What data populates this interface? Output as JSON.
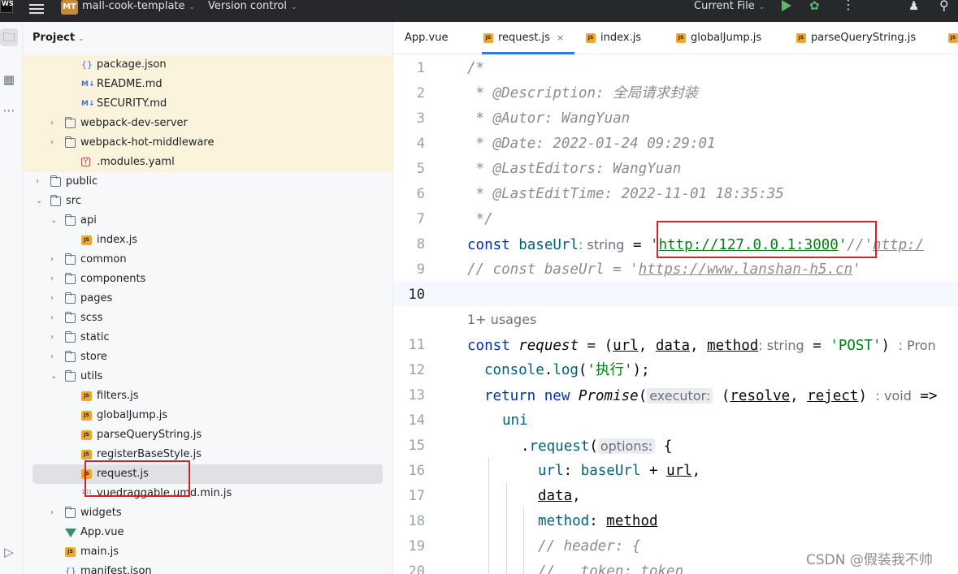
{
  "topbar": {
    "logo": "WS",
    "project_badge": "MT",
    "project_name": "mall-cook-template",
    "vcs": "Version control",
    "run_config": "Current File"
  },
  "project_panel": {
    "title": "Project",
    "tree": [
      {
        "label": "package.json",
        "icon": "json-icon",
        "indent": 3,
        "expand": ""
      },
      {
        "label": "README.md",
        "icon": "markdown-icon",
        "indent": 3,
        "expand": ""
      },
      {
        "label": "SECURITY.md",
        "icon": "markdown-icon",
        "indent": 3,
        "expand": ""
      },
      {
        "label": "webpack-dev-server",
        "icon": "folder-icon",
        "indent": 2,
        "expand": "›"
      },
      {
        "label": "webpack-hot-middleware",
        "icon": "folder-icon",
        "indent": 2,
        "expand": "›"
      },
      {
        "label": ".modules.yaml",
        "icon": "yaml-icon",
        "indent": 3,
        "expand": ""
      },
      {
        "label": "public",
        "icon": "folder-icon",
        "indent": 1,
        "expand": "›"
      },
      {
        "label": "src",
        "icon": "folder-icon",
        "indent": 1,
        "expand": "⌄"
      },
      {
        "label": "api",
        "icon": "folder-icon",
        "indent": 2,
        "expand": "⌄"
      },
      {
        "label": "index.js",
        "icon": "js-icon",
        "indent": 3,
        "expand": ""
      },
      {
        "label": "common",
        "icon": "folder-icon",
        "indent": 2,
        "expand": "›"
      },
      {
        "label": "components",
        "icon": "folder-icon",
        "indent": 2,
        "expand": "›"
      },
      {
        "label": "pages",
        "icon": "folder-icon",
        "indent": 2,
        "expand": "›"
      },
      {
        "label": "scss",
        "icon": "folder-icon",
        "indent": 2,
        "expand": "›"
      },
      {
        "label": "static",
        "icon": "folder-icon",
        "indent": 2,
        "expand": "›"
      },
      {
        "label": "store",
        "icon": "folder-icon",
        "indent": 2,
        "expand": "›"
      },
      {
        "label": "utils",
        "icon": "folder-icon",
        "indent": 2,
        "expand": "⌄"
      },
      {
        "label": "filters.js",
        "icon": "js-icon",
        "indent": 3,
        "expand": ""
      },
      {
        "label": "globalJump.js",
        "icon": "js-icon",
        "indent": 3,
        "expand": ""
      },
      {
        "label": "parseQueryString.js",
        "icon": "js-icon",
        "indent": 3,
        "expand": ""
      },
      {
        "label": "registerBaseStyle.js",
        "icon": "js-icon",
        "indent": 3,
        "expand": ""
      },
      {
        "label": "request.js",
        "icon": "js-icon",
        "indent": 3,
        "expand": "",
        "selected": true
      },
      {
        "label": "vuedraggable.umd.min.js",
        "icon": "min-js-icon",
        "indent": 3,
        "expand": ""
      },
      {
        "label": "widgets",
        "icon": "folder-icon",
        "indent": 2,
        "expand": "›"
      },
      {
        "label": "App.vue",
        "icon": "vue-icon",
        "indent": 2,
        "expand": ""
      },
      {
        "label": "main.js",
        "icon": "js-icon",
        "indent": 2,
        "expand": ""
      },
      {
        "label": "manifest.json",
        "icon": "json-icon",
        "indent": 2,
        "expand": ""
      }
    ]
  },
  "tabs": [
    {
      "label": "App.vue",
      "icon": "vue-icon"
    },
    {
      "label": "request.js",
      "icon": "js-icon",
      "active": true,
      "close": "×"
    },
    {
      "label": "index.js",
      "icon": "js-icon"
    },
    {
      "label": "globalJump.js",
      "icon": "js-icon"
    },
    {
      "label": "parseQueryString.js",
      "icon": "js-icon"
    }
  ],
  "editor": {
    "line_numbers": [
      "1",
      "2",
      "3",
      "4",
      "5",
      "6",
      "7",
      "8",
      "9",
      "10",
      "11",
      "12",
      "13",
      "14",
      "15",
      "16",
      "17",
      "18",
      "19",
      "20"
    ],
    "current_line": "10",
    "usages_hint": "1+ usages",
    "lines": {
      "l1": "/*",
      "l2_tag": " * @Description:",
      "l2_text": " 全局请求封装",
      "l3_tag": " * @Autor:",
      "l3_text": " WangYuan",
      "l4_tag": " * @Date:",
      "l4_text": " 2022-01-24 09:29:01",
      "l5_tag": " * @LastEditors:",
      "l5_text": " WangYuan",
      "l6_tag": " * @LastEditTime:",
      "l6_text": " 2022-11-01 18:35:35",
      "l7": " */",
      "l8_kw": "const",
      "l8_var": "baseUrl",
      "l8_hint": ": string",
      "l8_eq": " = ",
      "l8_q1": "'",
      "l8_url": "http://127.0.0.1:3000",
      "l8_q2": "'",
      "l8_tail_cm": "//'",
      "l8_tail_link": "http:/",
      "l9_cm": "// const baseUrl = '",
      "l9_link": "https://www.lanshan-h5.cn",
      "l9_cm2": "'",
      "l11_kw": "const",
      "l11_name": "request",
      "l11_eq": " = (",
      "l11_p1": "url",
      "l11_c1": ", ",
      "l11_p2": "data",
      "l11_c2": ", ",
      "l11_p3": "method",
      "l11_hint": ": string",
      "l11_def": " = ",
      "l11_str": "'POST'",
      "l11_close": ")",
      "l11_rhint": ": Pron",
      "l12_obj": "console",
      "l12_dot": ".",
      "l12_fn": "log",
      "l12_open": "(",
      "l12_str": "'执行'",
      "l12_close": ");",
      "l13_kw1": "return",
      "l13_kw2": "new",
      "l13_cls": "Promise",
      "l13_open": "(",
      "l13_hint": "executor:",
      "l13_args_open": " (",
      "l13_a1": "resolve",
      "l13_comma": ", ",
      "l13_a2": "reject",
      "l13_args_close": ")",
      "l13_rhint": ": void",
      "l13_arrow": " =>",
      "l14": "uni",
      "l15_dot": ".",
      "l15_fn": "request",
      "l15_open": "(",
      "l15_hint": "options:",
      "l15_brace": " {",
      "l16_key": "url",
      "l16_colon": ": ",
      "l16_var": "baseUrl",
      "l16_plus": " + ",
      "l16_u": "url",
      "l16_comma": ",",
      "l17_key": "data",
      "l17_comma": ",",
      "l18_key": "method",
      "l18_colon": ": ",
      "l18_val": "method",
      "l19": "// header: {",
      "l20": "//   token: token"
    }
  },
  "watermark": "CSDN @假装我不帅",
  "colors": {
    "keyword": "#0033b3",
    "string": "#067d17",
    "comment": "#8c8c8c",
    "function": "#00627a",
    "highlight_box": "#e02020",
    "tab_underline": "#3574f0"
  }
}
